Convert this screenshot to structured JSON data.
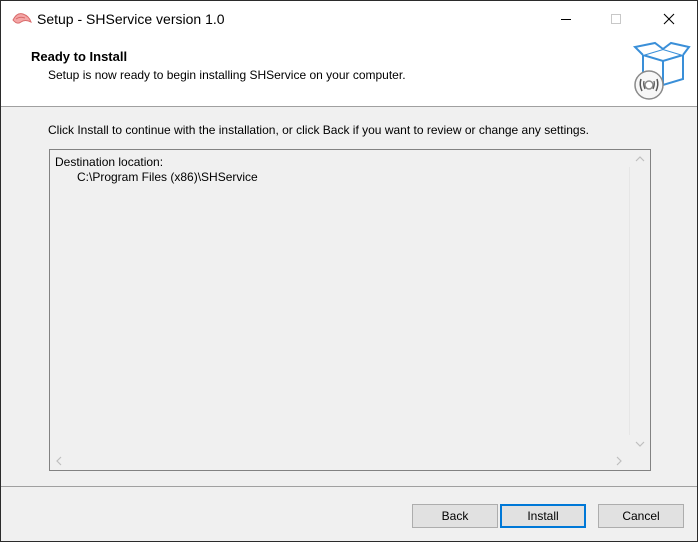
{
  "window": {
    "title": "Setup - SHService version 1.0",
    "app_icon": "setup-app-icon"
  },
  "header": {
    "title": "Ready to Install",
    "subtitle": "Setup is now ready to begin installing SHService on your computer.",
    "image_icon": "install-box-disc-icon"
  },
  "body": {
    "info": "Click Install to continue with the installation, or click Back if you want to review or change any settings.",
    "memo": {
      "line1": "Destination location:",
      "line2": "C:\\Program Files (x86)\\SHService"
    }
  },
  "buttons": {
    "back": "Back",
    "install": "Install",
    "cancel": "Cancel"
  },
  "colors": {
    "default_button_border": "#0078d7",
    "face": "#f0f0f0"
  }
}
